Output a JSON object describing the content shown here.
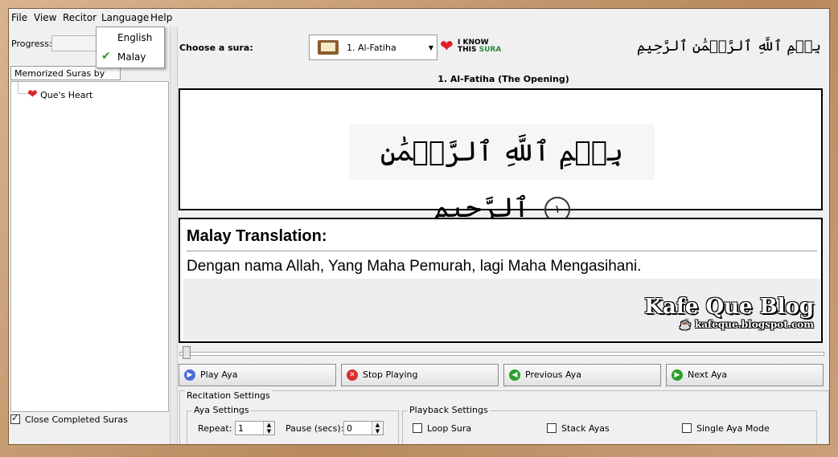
{
  "menu": {
    "file": "File",
    "view": "View",
    "reciter": "Recitor",
    "language": "Language",
    "help": "Help"
  },
  "language_menu": {
    "items": [
      "English",
      "Malay"
    ],
    "selected": "Malay"
  },
  "left_panel": {
    "progress_label": "Progress:",
    "tree_header": "Memorized Suras by Heart",
    "tree_items": [
      "Que's Heart"
    ],
    "close_completed_label": "Close Completed Suras",
    "close_completed_checked": true
  },
  "top_bar": {
    "choose_label": "Choose a sura:",
    "selected_sura": "1. Al-Fatiha",
    "iknow_line1": "I KNOW",
    "iknow_line2a": "THIS",
    "iknow_line2b": "SURA",
    "basmala_small": "بِسۡمِ ٱللَّهِ ٱلرَّحۡمَٰنِ ٱلرَّحِيمِ"
  },
  "sura_title": "1. Al-Fatiha (The Opening)",
  "aya": {
    "arabic": "بِسۡمِ ٱللَّهِ ٱلرَّحۡمَٰنِ ٱلرَّحِيمِ",
    "number": "١"
  },
  "translation": {
    "title": "Malay Translation:",
    "text": "Dengan nama Allah, Yang Maha Pemurah, lagi Maha Mengasihani."
  },
  "watermark": {
    "title": "Kafe Que Blog",
    "url": "kafeque.blogspot.com"
  },
  "buttons": {
    "play": "Play Aya",
    "stop": "Stop Playing",
    "previous": "Previous Aya",
    "next": "Next Aya"
  },
  "recitation": {
    "group_label": "Recitation Settings",
    "aya_settings_label": "Aya Settings",
    "repeat_label": "Repeat:",
    "repeat_value": "1",
    "pause_label": "Pause (secs):",
    "pause_value": "0",
    "playback_label": "Playback Settings",
    "loop_sura": "Loop Sura",
    "stack_ayas": "Stack Ayas",
    "single_aya": "Single Aya Mode"
  },
  "colors": {
    "heart": "#e0202a",
    "sura_green": "#2a8a3a",
    "frame": "#c8a27a"
  }
}
